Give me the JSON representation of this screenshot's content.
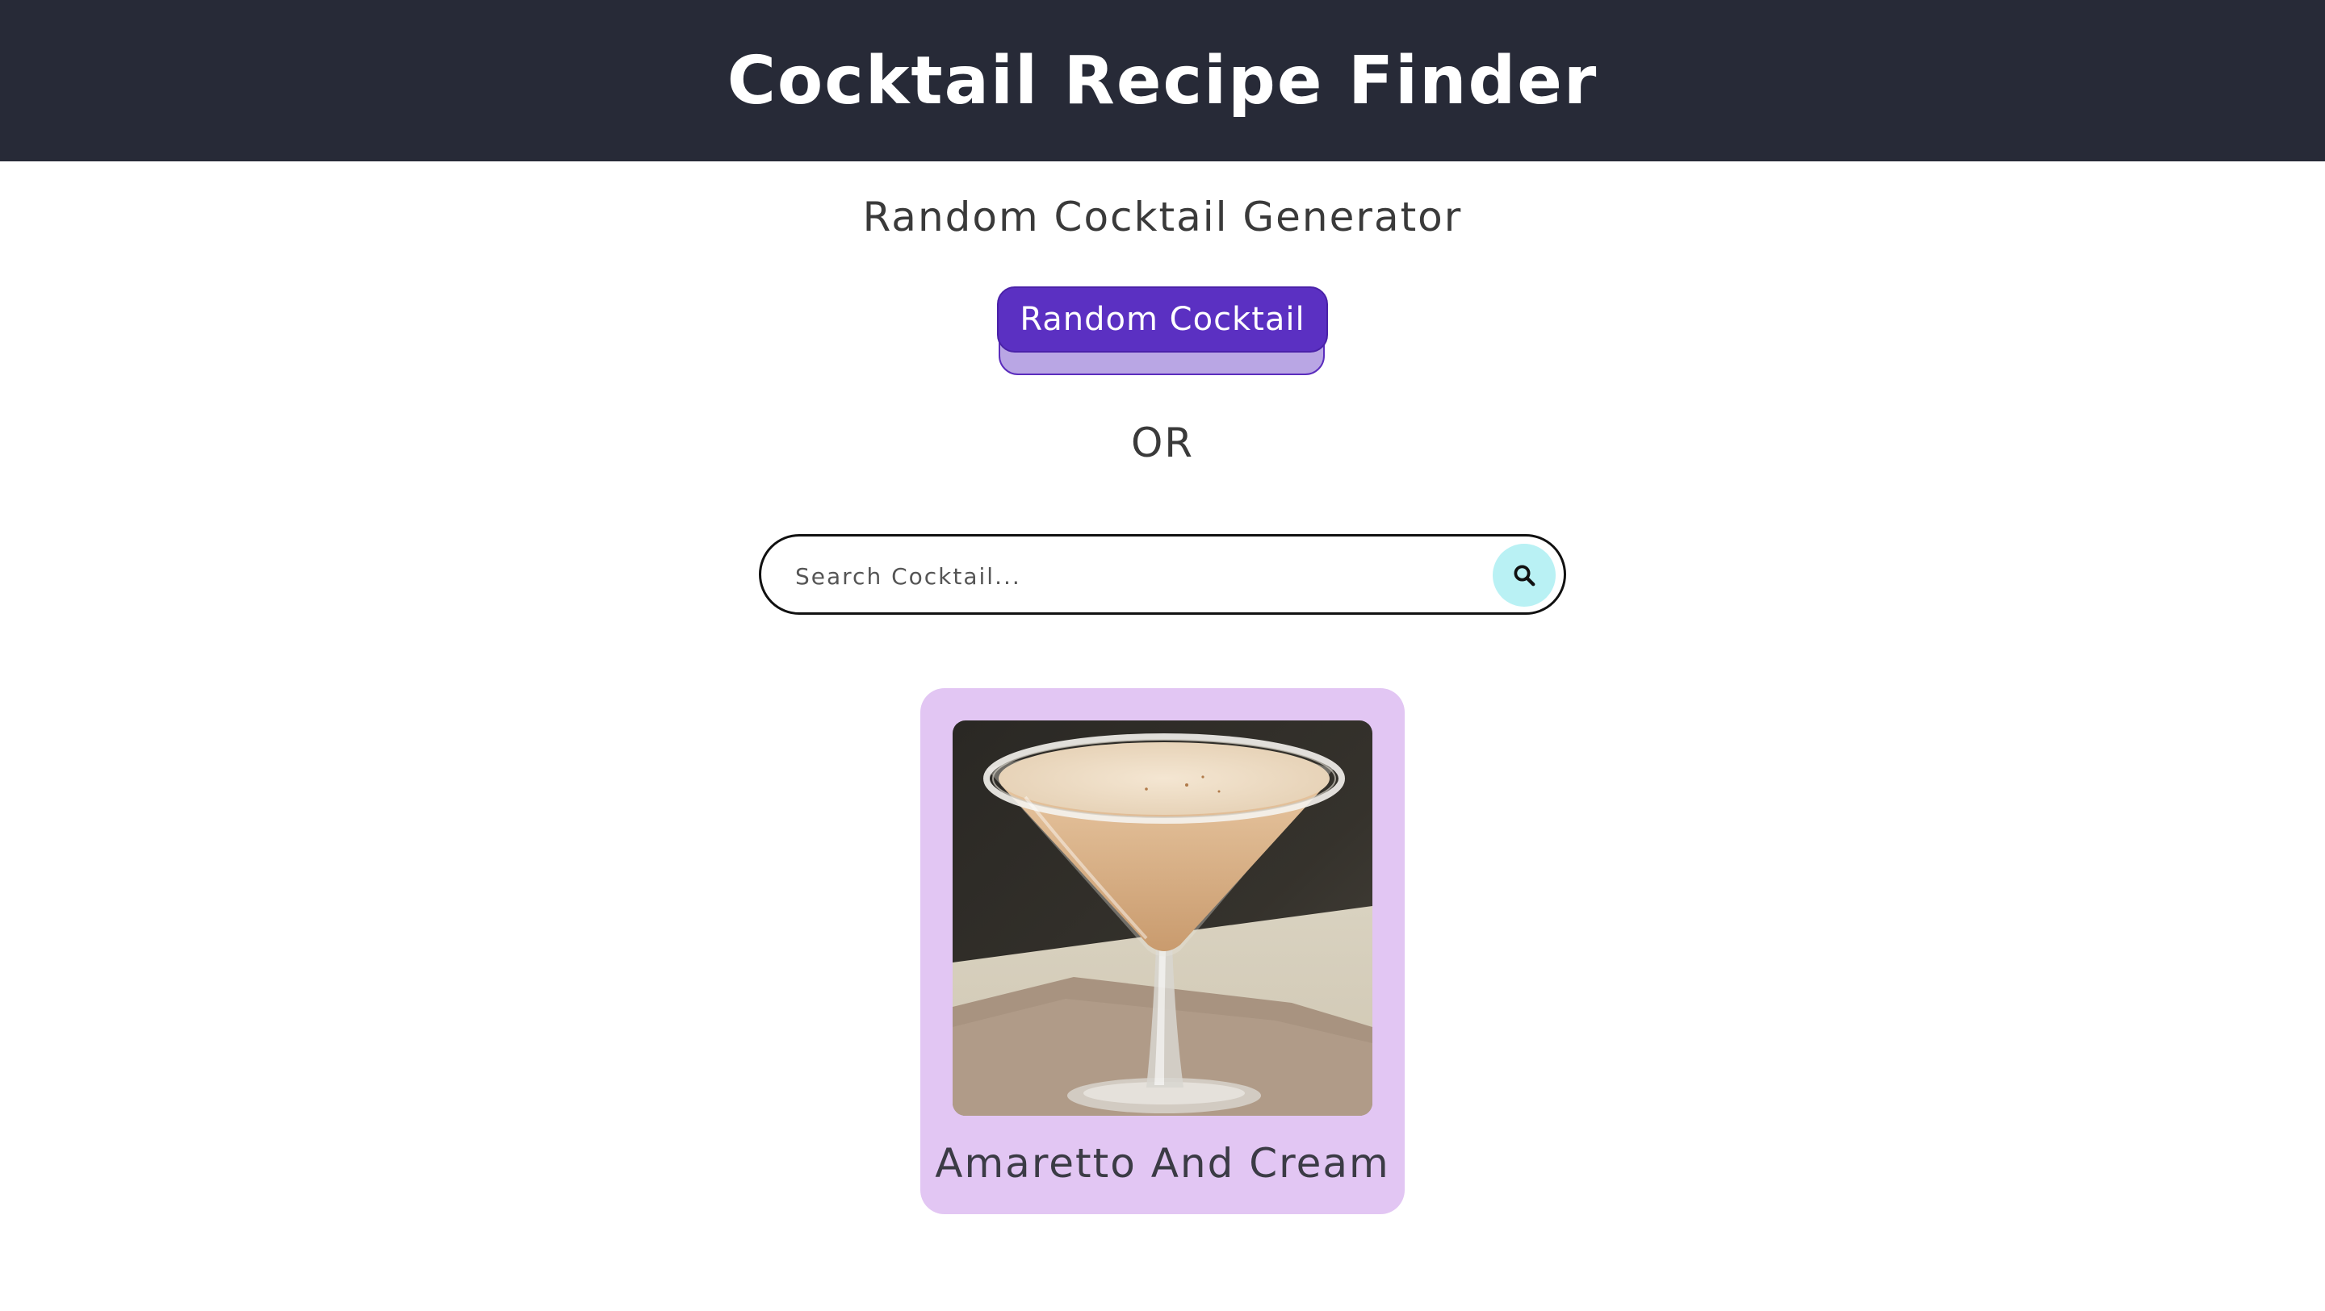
{
  "header": {
    "title": "Cocktail Recipe Finder"
  },
  "random_section": {
    "title": "Random Cocktail Generator",
    "button_label": "Random Cocktail"
  },
  "divider": {
    "label": "OR"
  },
  "search": {
    "placeholder": "Search Cocktail...",
    "value": "",
    "button_icon": "search-icon"
  },
  "result_card": {
    "name": "Amaretto And Cream",
    "image_icon": "cocktail-photo"
  },
  "colors": {
    "header_bg": "#272a37",
    "button_bg": "#5b30c2",
    "button_shadow": "#b9a6e4",
    "search_button_bg": "#b9f1f4",
    "card_bg": "#e2c6f3"
  }
}
